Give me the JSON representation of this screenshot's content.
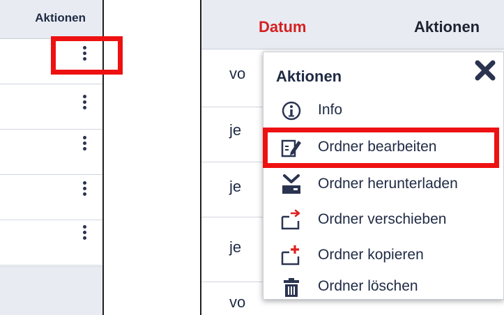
{
  "left_panel": {
    "header": "Aktionen",
    "row_count": 5
  },
  "right_panel": {
    "headers": {
      "datum": "Datum",
      "aktionen": "Aktionen"
    },
    "row_texts": [
      "vo",
      "je",
      "je",
      "je",
      "vo"
    ]
  },
  "menu": {
    "title": "Aktionen",
    "items": [
      {
        "label": "Info",
        "icon": "info-icon"
      },
      {
        "label": "Ordner bearbeiten",
        "icon": "edit-folder-icon"
      },
      {
        "label": "Ordner herunterladen",
        "icon": "download-icon"
      },
      {
        "label": "Ordner verschieben",
        "icon": "move-folder-icon"
      },
      {
        "label": "Ordner kopieren",
        "icon": "copy-folder-icon"
      },
      {
        "label": "Ordner löschen",
        "icon": "trash-icon"
      }
    ]
  },
  "colors": {
    "accent_red": "#ee1111",
    "sort_header": "#d42020",
    "icon_navy": "#2a3350"
  },
  "highlights": [
    "first-row-actions-button",
    "menu-item-ordner-bearbeiten"
  ]
}
